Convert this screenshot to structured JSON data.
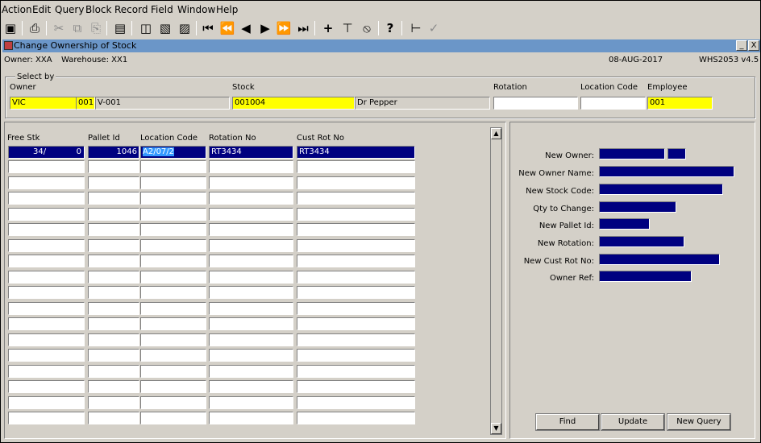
{
  "menu": [
    "Action",
    "Edit",
    "Query",
    "Block",
    "Record",
    "Field",
    "Window",
    "Help"
  ],
  "toolbar_icons": [
    "save-icon",
    "print-icon",
    "cut-icon",
    "copy-icon",
    "paste-icon",
    "clear-field-icon",
    "query-icon",
    "enter-query-icon",
    "execute-query-icon",
    "first-record-icon",
    "previous-set-icon",
    "previous-record-icon",
    "next-record-icon",
    "next-set-icon",
    "last-record-icon",
    "insert-record-icon",
    "delete-record-icon",
    "clear-record-icon",
    "help-icon",
    "exit-icon",
    "commit-icon"
  ],
  "window": {
    "title": "Change Ownership of Stock",
    "minimize": "_",
    "close": "X"
  },
  "info": {
    "owner_text": "Owner:  XXA",
    "warehouse_text": "Warehouse:  XX1",
    "date": "08-AUG-2017",
    "version": "WHS2053  v4.5"
  },
  "select_by": {
    "legend": "Select by",
    "owner_label": "Owner",
    "owner_code": "VIC",
    "owner_num": "001",
    "owner_name": "V-001",
    "stock_label": "Stock",
    "stock_code": "001004",
    "stock_desc": "Dr Pepper",
    "rotation_label": "Rotation",
    "rotation_value": "",
    "location_label": "Location Code",
    "location_value": "",
    "employee_label": "Employee",
    "employee_value": "001"
  },
  "grid": {
    "columns": [
      "Free Stk",
      "Pallet Id",
      "Location Code",
      "Rotation No",
      "Cust Rot No"
    ],
    "rows": [
      {
        "free_qty": "34/",
        "free_sub": "0",
        "pallet": "1046",
        "location": "A2/07/2",
        "rotation": "RT3434",
        "cust_rot": "RT3434"
      }
    ],
    "blank_rows": 17
  },
  "new_fields": {
    "new_owner": "New Owner:",
    "new_owner_name": "New Owner Name:",
    "new_stock_code": "New Stock Code:",
    "qty_to_change": "Qty to Change:",
    "new_pallet_id": "New Pallet Id:",
    "new_rotation": "New Rotation:",
    "new_cust_rot_no": "New Cust Rot No:",
    "owner_ref": "Owner Ref:"
  },
  "buttons": {
    "find": "Find",
    "update": "Update",
    "new_query": "New Query"
  },
  "colors": {
    "window_title_bg": "#6b96c8",
    "required_field": "#ffff00",
    "selected_row": "#000080",
    "form_bg": "#d4d0c8"
  }
}
